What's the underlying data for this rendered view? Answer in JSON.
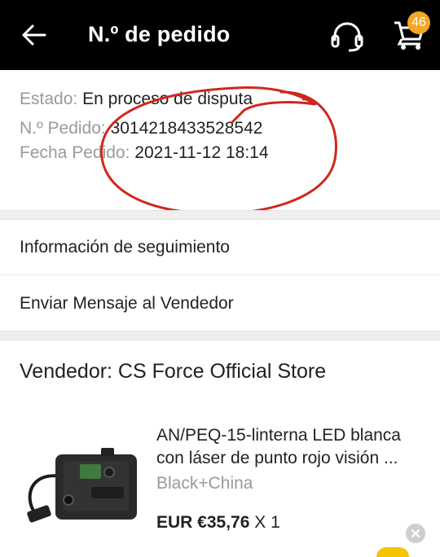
{
  "header": {
    "title": "N.º de pedido",
    "cart_count": "46"
  },
  "order": {
    "status_label": "Estado:",
    "status_value": "En proceso de disputa",
    "number_label": "N.º Pedido:",
    "number_value": "3014218433528542",
    "date_label": "Fecha Pedido:",
    "date_value": "2021-11-12 18:14"
  },
  "links": {
    "tracking": "Información de seguimiento",
    "message_seller": "Enviar Mensaje al Vendedor"
  },
  "seller": {
    "label": "Vendedor: CS Force Official Store"
  },
  "product": {
    "title": "AN/PEQ-15-linterna LED blanca con láser de punto rojo visión ...",
    "variant": "Black+China",
    "price": "EUR €35,76",
    "quantity": "X 1"
  },
  "colors": {
    "header_bg": "#000000",
    "badge": "#f5a623",
    "annotation_circle": "#d0271d",
    "label_grey": "#9a9a9a"
  },
  "icons": [
    "back-arrow-icon",
    "headset-support-icon",
    "shopping-cart-icon",
    "close-icon"
  ]
}
